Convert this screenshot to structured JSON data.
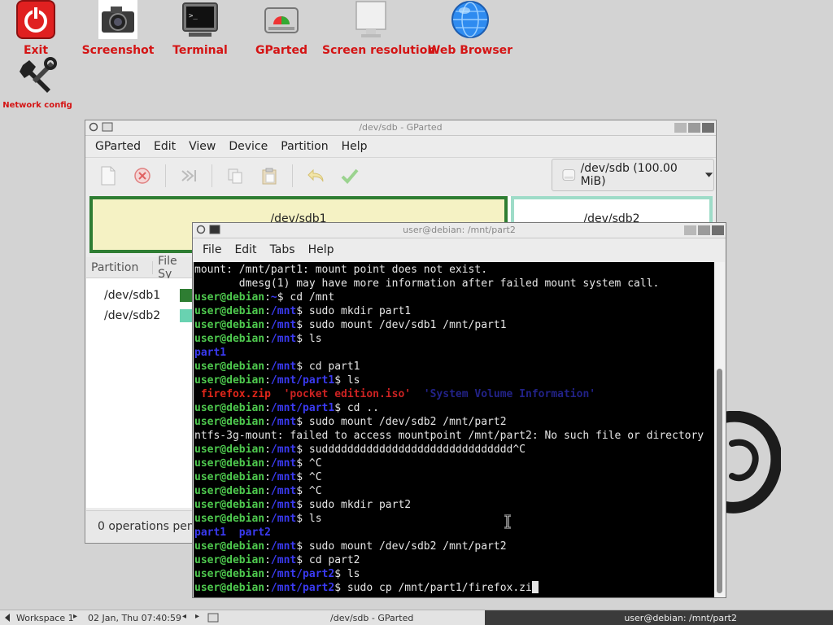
{
  "desktop": {
    "icons": [
      {
        "label": "Exit",
        "icon": "power-icon"
      },
      {
        "label": "Screenshot",
        "icon": "camera-icon"
      },
      {
        "label": "Terminal",
        "icon": "terminal-icon"
      },
      {
        "label": "GParted",
        "icon": "disk-icon"
      },
      {
        "label": "Screen resolution",
        "icon": "monitor-icon"
      },
      {
        "label": "Web Browser",
        "icon": "globe-icon"
      },
      {
        "label": "Network config",
        "icon": "wrench-icon"
      }
    ],
    "label_color": "#d41414"
  },
  "gparted": {
    "title": "/dev/sdb - GParted",
    "menu": [
      "GParted",
      "Edit",
      "View",
      "Device",
      "Partition",
      "Help"
    ],
    "device": "/dev/sdb (100.00 MiB)",
    "partitions_map": [
      "/dev/sdb1",
      "/dev/sdb2"
    ],
    "columns": [
      "Partition",
      "File Sy"
    ],
    "rows": [
      {
        "name": "/dev/sdb1",
        "color": "#2e7d32"
      },
      {
        "name": "/dev/sdb2",
        "color": "#69d2b1"
      }
    ],
    "status": "0 operations pendi"
  },
  "terminal": {
    "title": "user@debian: /mnt/part2",
    "menu": [
      "File",
      "Edit",
      "Tabs",
      "Help"
    ],
    "lines": [
      [
        {
          "t": "mount: /mnt/part1: mount point does not exist.",
          "c": "tl-plain"
        }
      ],
      [
        {
          "t": "       dmesg(1) may have more information after failed mount system call.",
          "c": "tl-plain"
        }
      ],
      [
        {
          "t": "user@debian",
          "c": "tl-user"
        },
        {
          "t": ":",
          "c": "tl-plain"
        },
        {
          "t": "~",
          "c": "tl-path"
        },
        {
          "t": "$ cd /mnt",
          "c": "tl-plain"
        }
      ],
      [
        {
          "t": "user@debian",
          "c": "tl-user"
        },
        {
          "t": ":",
          "c": "tl-plain"
        },
        {
          "t": "/mnt",
          "c": "tl-path"
        },
        {
          "t": "$ sudo mkdir part1",
          "c": "tl-plain"
        }
      ],
      [
        {
          "t": "user@debian",
          "c": "tl-user"
        },
        {
          "t": ":",
          "c": "tl-plain"
        },
        {
          "t": "/mnt",
          "c": "tl-path"
        },
        {
          "t": "$ sudo mount /dev/sdb1 /mnt/part1",
          "c": "tl-plain"
        }
      ],
      [
        {
          "t": "user@debian",
          "c": "tl-user"
        },
        {
          "t": ":",
          "c": "tl-plain"
        },
        {
          "t": "/mnt",
          "c": "tl-path"
        },
        {
          "t": "$ ls",
          "c": "tl-plain"
        }
      ],
      [
        {
          "t": "part1",
          "c": "tl-dir"
        }
      ],
      [
        {
          "t": "user@debian",
          "c": "tl-user"
        },
        {
          "t": ":",
          "c": "tl-plain"
        },
        {
          "t": "/mnt",
          "c": "tl-path"
        },
        {
          "t": "$ cd part1",
          "c": "tl-plain"
        }
      ],
      [
        {
          "t": "user@debian",
          "c": "tl-user"
        },
        {
          "t": ":",
          "c": "tl-plain"
        },
        {
          "t": "/mnt/part1",
          "c": "tl-path"
        },
        {
          "t": "$ ls",
          "c": "tl-plain"
        }
      ],
      [
        {
          "t": " firefox.zip",
          "c": "tl-zip"
        },
        {
          "t": "  ",
          "c": "tl-plain"
        },
        {
          "t": "'pocket edition.iso'",
          "c": "tl-iso"
        },
        {
          "t": "  ",
          "c": "tl-plain"
        },
        {
          "t": "'System Volume Information'",
          "c": "tl-hidden"
        }
      ],
      [
        {
          "t": "user@debian",
          "c": "tl-user"
        },
        {
          "t": ":",
          "c": "tl-plain"
        },
        {
          "t": "/mnt/part1",
          "c": "tl-path"
        },
        {
          "t": "$ cd ..",
          "c": "tl-plain"
        }
      ],
      [
        {
          "t": "user@debian",
          "c": "tl-user"
        },
        {
          "t": ":",
          "c": "tl-plain"
        },
        {
          "t": "/mnt",
          "c": "tl-path"
        },
        {
          "t": "$ sudo mount /dev/sdb2 /mnt/part2",
          "c": "tl-plain"
        }
      ],
      [
        {
          "t": "ntfs-3g-mount: failed to access mountpoint /mnt/part2: No such file or directory",
          "c": "tl-plain"
        }
      ],
      [
        {
          "t": "user@debian",
          "c": "tl-user"
        },
        {
          "t": ":",
          "c": "tl-plain"
        },
        {
          "t": "/mnt",
          "c": "tl-path"
        },
        {
          "t": "$ sudddddddddddddddddddddddddddddd^C",
          "c": "tl-plain"
        }
      ],
      [
        {
          "t": "user@debian",
          "c": "tl-user"
        },
        {
          "t": ":",
          "c": "tl-plain"
        },
        {
          "t": "/mnt",
          "c": "tl-path"
        },
        {
          "t": "$ ^C",
          "c": "tl-plain"
        }
      ],
      [
        {
          "t": "user@debian",
          "c": "tl-user"
        },
        {
          "t": ":",
          "c": "tl-plain"
        },
        {
          "t": "/mnt",
          "c": "tl-path"
        },
        {
          "t": "$ ^C",
          "c": "tl-plain"
        }
      ],
      [
        {
          "t": "user@debian",
          "c": "tl-user"
        },
        {
          "t": ":",
          "c": "tl-plain"
        },
        {
          "t": "/mnt",
          "c": "tl-path"
        },
        {
          "t": "$ ^C",
          "c": "tl-plain"
        }
      ],
      [
        {
          "t": "user@debian",
          "c": "tl-user"
        },
        {
          "t": ":",
          "c": "tl-plain"
        },
        {
          "t": "/mnt",
          "c": "tl-path"
        },
        {
          "t": "$ sudo mkdir part2",
          "c": "tl-plain"
        }
      ],
      [
        {
          "t": "user@debian",
          "c": "tl-user"
        },
        {
          "t": ":",
          "c": "tl-plain"
        },
        {
          "t": "/mnt",
          "c": "tl-path"
        },
        {
          "t": "$ ls",
          "c": "tl-plain"
        }
      ],
      [
        {
          "t": "part1  part2",
          "c": "tl-dir"
        }
      ],
      [
        {
          "t": "user@debian",
          "c": "tl-user"
        },
        {
          "t": ":",
          "c": "tl-plain"
        },
        {
          "t": "/mnt",
          "c": "tl-path"
        },
        {
          "t": "$ sudo mount /dev/sdb2 /mnt/part2",
          "c": "tl-plain"
        }
      ],
      [
        {
          "t": "user@debian",
          "c": "tl-user"
        },
        {
          "t": ":",
          "c": "tl-plain"
        },
        {
          "t": "/mnt",
          "c": "tl-path"
        },
        {
          "t": "$ cd part2",
          "c": "tl-plain"
        }
      ],
      [
        {
          "t": "user@debian",
          "c": "tl-user"
        },
        {
          "t": ":",
          "c": "tl-plain"
        },
        {
          "t": "/mnt/part2",
          "c": "tl-path"
        },
        {
          "t": "$ ls",
          "c": "tl-plain"
        }
      ],
      [
        {
          "t": "user@debian",
          "c": "tl-user"
        },
        {
          "t": ":",
          "c": "tl-plain"
        },
        {
          "t": "/mnt/part2",
          "c": "tl-path"
        },
        {
          "t": "$ sudo cp /mnt/part1/firefox.zi",
          "c": "tl-plain"
        }
      ]
    ]
  },
  "taskbar": {
    "workspace": "Workspace 1",
    "datetime": "02 Jan, Thu 07:40:59",
    "task_gparted": "/dev/sdb - GParted",
    "task_terminal": "user@debian: /mnt/part2"
  }
}
